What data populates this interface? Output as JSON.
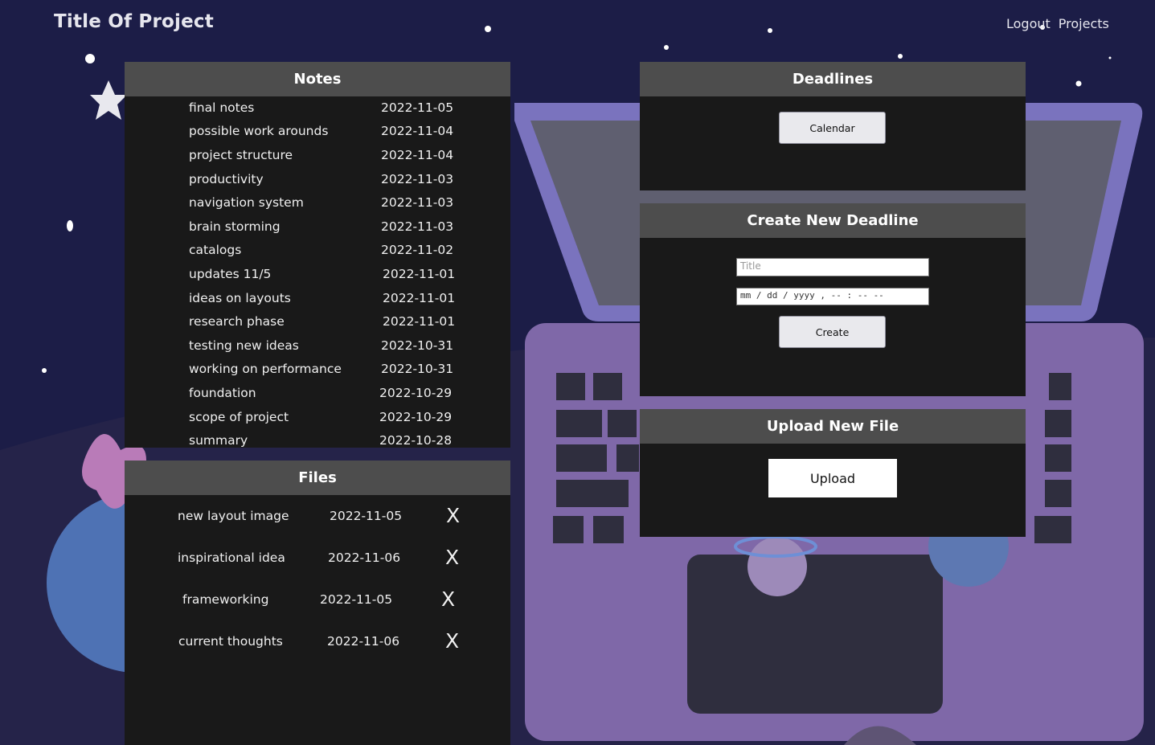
{
  "header": {
    "title": "Title Of Project",
    "nav": {
      "logout": "Logout",
      "projects": "Projects"
    }
  },
  "notes": {
    "title": "Notes",
    "items": [
      {
        "title": "final notes",
        "date": "2022-11-05"
      },
      {
        "title": "possible work arounds",
        "date": "2022-11-04"
      },
      {
        "title": "project structure",
        "date": "2022-11-04"
      },
      {
        "title": "productivity",
        "date": "2022-11-03"
      },
      {
        "title": "navigation system",
        "date": "2022-11-03"
      },
      {
        "title": "brain storming",
        "date": "2022-11-03"
      },
      {
        "title": "catalogs",
        "date": "2022-11-02"
      },
      {
        "title": "updates 11/5",
        "date": "2022-11-01"
      },
      {
        "title": "ideas on layouts",
        "date": "2022-11-01"
      },
      {
        "title": "research phase",
        "date": "2022-11-01"
      },
      {
        "title": "testing new ideas",
        "date": "2022-10-31"
      },
      {
        "title": "working on performance",
        "date": "2022-10-31"
      },
      {
        "title": "foundation",
        "date": "2022-10-29"
      },
      {
        "title": "scope of project",
        "date": "2022-10-29"
      },
      {
        "title": "summary",
        "date": "2022-10-28"
      }
    ]
  },
  "files": {
    "title": "Files",
    "delete_label": "X",
    "items": [
      {
        "name": "new layout image",
        "date": "2022-11-05"
      },
      {
        "name": "inspirational idea",
        "date": "2022-11-06"
      },
      {
        "name": "frameworking",
        "date": "2022-11-05"
      },
      {
        "name": "current thoughts",
        "date": "2022-11-06"
      }
    ]
  },
  "deadlines": {
    "title": "Deadlines",
    "calendar_label": "Calendar"
  },
  "create_deadline": {
    "title": "Create New Deadline",
    "title_placeholder": "Title",
    "date_placeholder": "mm / dd / yyyy ,  -- : --  --",
    "create_label": "Create"
  },
  "upload": {
    "title": "Upload New File",
    "upload_label": "Upload"
  },
  "colors": {
    "background": "#1c1d47",
    "panel": "#191919",
    "panel_header": "#4d4d4d",
    "laptop": "#7f68a8"
  }
}
